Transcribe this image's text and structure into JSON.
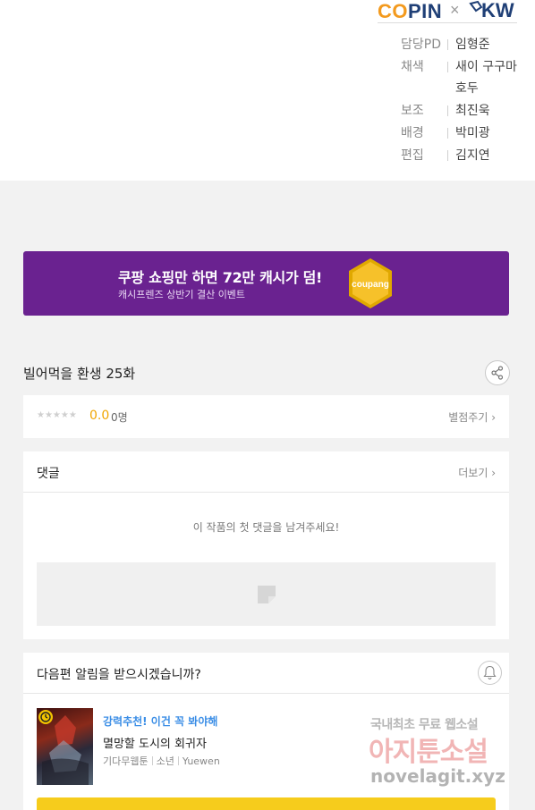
{
  "header": {
    "logo_left": "COPIN",
    "logo_cross": "×",
    "logo_right": "KW",
    "credits": [
      {
        "role": "담당PD",
        "name": "임형준"
      },
      {
        "role": "채색",
        "name": "새이 구구마 호두"
      },
      {
        "role": "보조",
        "name": "최진욱"
      },
      {
        "role": "배경",
        "name": "박미광"
      },
      {
        "role": "편집",
        "name": "김지연"
      }
    ]
  },
  "banner": {
    "headline": "쿠팡 쇼핑만 하면 72만 캐시가 덤!",
    "subline": "캐시프렌즈 상반기 결산 이벤트",
    "coin_text": "coupang",
    "bg_color": "#6a2290"
  },
  "episode": {
    "title": "빌어먹을 환생 25화"
  },
  "rating": {
    "stars": "★★★★★",
    "score": "0.0",
    "count": "0명",
    "rate_label": "별점주기 ›"
  },
  "comments": {
    "title": "댓글",
    "more_label": "더보기 ›",
    "empty_text": "이 작품의 첫 댓글을 남겨주세요!"
  },
  "notify": {
    "question": "다음편 알림을 받으시겠습니까?",
    "recommend": {
      "badge": "강력추천! 이건 꼭 봐야해",
      "title": "멸망할 도시의 회귀자",
      "meta": [
        "기다무웹툰",
        "소년",
        "Yuewen"
      ]
    },
    "button_color": "#f6cc1c"
  },
  "watermark": {
    "line1": "국내최초 무료 웹소설",
    "line2": "아지툰소설",
    "line3": "novelagit.xyz"
  }
}
